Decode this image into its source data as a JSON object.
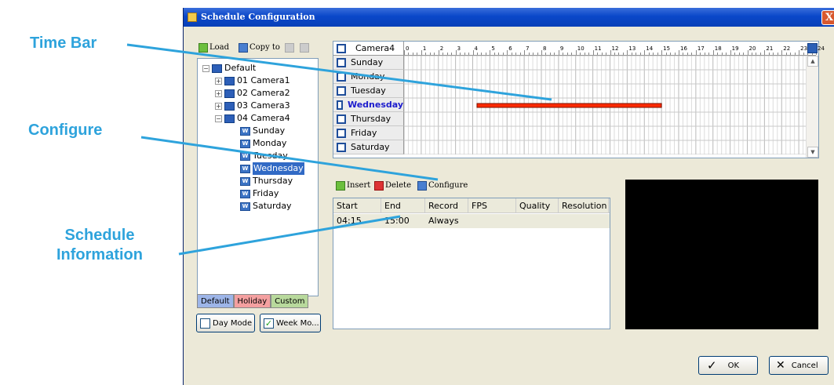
{
  "callouts": {
    "time_bar": "Time Bar",
    "configure": "Configure",
    "schedule_information": [
      "Schedule",
      "Information"
    ]
  },
  "window": {
    "title": "Schedule Configuration",
    "close": "X"
  },
  "toolbar": {
    "load": "Load",
    "copy_to": "Copy to"
  },
  "tree": {
    "root": "Default",
    "cameras": [
      "01 Camera1",
      "02 Camera2",
      "03 Camera3",
      "04 Camera4"
    ],
    "days": [
      "Sunday",
      "Monday",
      "Tuesday",
      "Wednesday",
      "Thursday",
      "Friday",
      "Saturday"
    ],
    "selected_day": "Wednesday"
  },
  "tabs": [
    "Default",
    "Holiday",
    "Custom"
  ],
  "mode_buttons": {
    "day": "Day Mode",
    "week": "Week Mo..."
  },
  "timebar": {
    "camera": "Camera4",
    "hours": [
      "0",
      "1",
      "2",
      "3",
      "4",
      "5",
      "6",
      "7",
      "8",
      "9",
      "10",
      "11",
      "12",
      "13",
      "14",
      "15",
      "16",
      "17",
      "18",
      "19",
      "20",
      "21",
      "22",
      "23",
      "24"
    ],
    "days": [
      "Sunday",
      "Monday",
      "Tuesday",
      "Wednesday",
      "Thursday",
      "Friday",
      "Saturday"
    ],
    "highlighted_day": "Wednesday",
    "schedule": {
      "day": "Wednesday",
      "start_hour": 4.25,
      "end_hour": 15.0
    },
    "bar_color": "#ff2a00"
  },
  "actions": {
    "insert": "Insert",
    "delete": "Delete",
    "configure": "Configure"
  },
  "schedule_list": {
    "columns": [
      "Start Time",
      "End Time",
      "Record",
      "FPS",
      "Quality",
      "Resolution"
    ],
    "rows": [
      {
        "start": "04:15",
        "end": "15:00",
        "record": "Always",
        "fps": "",
        "quality": "",
        "resolution": ""
      }
    ]
  },
  "footer": {
    "ok": "OK",
    "cancel": "Cancel"
  },
  "colors": {
    "callout": "#2ea3dc",
    "titlebar": "#0a47c9",
    "selection": "#316ac5"
  }
}
